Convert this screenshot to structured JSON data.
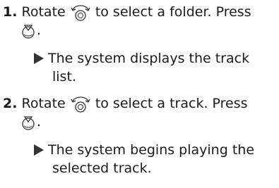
{
  "steps": [
    {
      "number": "1.",
      "instruction_part1": "Rotate",
      "rotate_icon": "interface-dial-rotate-icon",
      "instruction_part2": "to select a folder. Press",
      "press_icon": "interface-dial-press-icon",
      "instruction_end": ".",
      "result_line1": "The system displays the track",
      "result_line2": "list."
    },
    {
      "number": "2.",
      "instruction_part1": "Rotate",
      "rotate_icon": "interface-dial-rotate-icon",
      "instruction_part2": "to select a track. Press",
      "press_icon": "interface-dial-press-icon",
      "instruction_end": ".",
      "result_line1": "The system begins playing the",
      "result_line2": "selected track."
    }
  ],
  "colors": {
    "text": "#1a1a1a",
    "icon": "#333333"
  }
}
